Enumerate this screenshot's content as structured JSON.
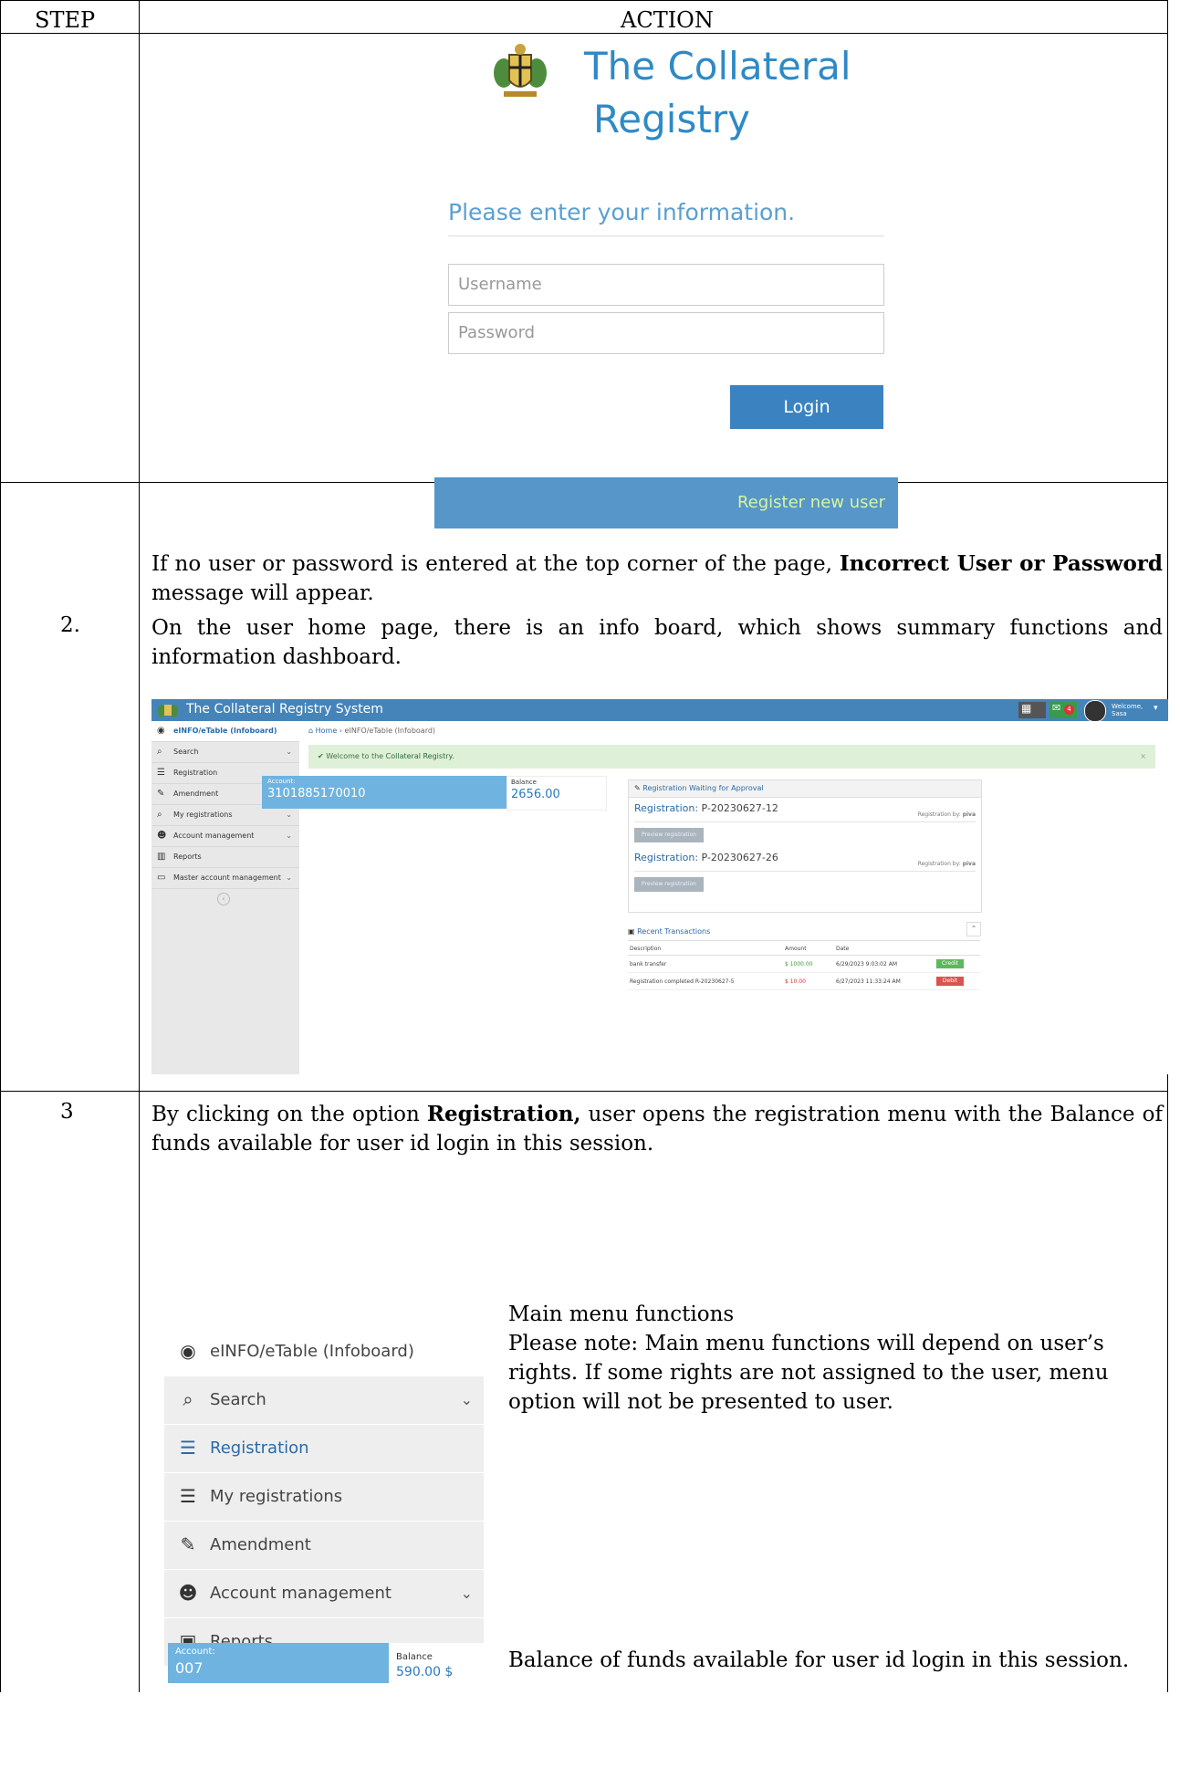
{
  "table": {
    "header_step": "STEP",
    "header_action": "ACTION"
  },
  "step1": {
    "logo_title_line1": "The Collateral",
    "logo_title_line2": "Registry",
    "prompt": "Please enter your information.",
    "username_placeholder": "Username",
    "password_placeholder": "Password",
    "login_label": "Login",
    "register_label": "Register new user",
    "note_pre": "If no user or password is entered at the top corner of the page, ",
    "note_bold": "Incorrect User or Password",
    "note_post": " message will appear."
  },
  "step2": {
    "number": "2.",
    "text": "On the user home page, there is an info board, which shows summary functions and information dashboard.",
    "app_title": "The Collateral Registry System",
    "welcome_user": "Welcome, Sasa",
    "notif_count": "4",
    "sidebar": [
      {
        "icon": "dashboard-icon",
        "glyph": "◉",
        "label": "eINFO/eTable (Infoboard)",
        "chev": ""
      },
      {
        "icon": "search-icon",
        "glyph": "⌕",
        "label": "Search",
        "chev": "⌄"
      },
      {
        "icon": "list-icon",
        "glyph": "☰",
        "label": "Registration",
        "chev": ""
      },
      {
        "icon": "pencil-icon",
        "glyph": "✎",
        "label": "Amendment",
        "chev": ""
      },
      {
        "icon": "search-icon",
        "glyph": "⌕",
        "label": "My registrations",
        "chev": "⌄"
      },
      {
        "icon": "users-icon",
        "glyph": "☻",
        "label": "Account management",
        "chev": "⌄"
      },
      {
        "icon": "chart-icon",
        "glyph": "▥",
        "label": "Reports",
        "chev": ""
      },
      {
        "icon": "monitor-icon",
        "glyph": "▭",
        "label": "Master account management",
        "chev": "⌄"
      }
    ],
    "breadcrumb_home": "Home",
    "breadcrumb_current": "eINFO/eTable (Infoboard)",
    "welcome_banner_pre": "✔ Welcome to the ",
    "welcome_banner_link": "Collateral Registry.",
    "account_label": "Account:",
    "account_number": "3101885170010",
    "balance_label": "Balance",
    "balance_value": "2656.00",
    "waiting_title": "Registration Waiting for Approval",
    "registrations": [
      {
        "label": "Registration:",
        "id": "P-20230627-12",
        "by_label": "Registration by:",
        "by": "piva",
        "button": "Preview registration"
      },
      {
        "label": "Registration:",
        "id": "P-20230627-26",
        "by_label": "Registration by:",
        "by": "piva",
        "button": "Preview registration"
      }
    ],
    "recent_title": "Recent Transactions",
    "tx_headers": [
      "Description",
      "Amount",
      "Date"
    ],
    "transactions": [
      {
        "description": "bank transfer",
        "amount": "$ 1000.00",
        "date": "6/29/2023 9:03:02 AM",
        "type": "Credit"
      },
      {
        "description": "Registration completed R-20230627-5",
        "amount": "$ 10.00",
        "date": "6/27/2023 11:33:24 AM",
        "type": "Debit"
      }
    ]
  },
  "step3": {
    "number": "3",
    "text_pre": "By clicking on the option ",
    "text_bold": "Registration,",
    "text_post": " user opens the registration menu with the Balance of funds available for user id login in this session.",
    "menu": [
      {
        "icon": "dashboard-icon",
        "glyph": "◉",
        "label": "eINFO/eTable (Infoboard)",
        "chev": ""
      },
      {
        "icon": "search-icon",
        "glyph": "⌕",
        "label": "Search",
        "chev": "⌄"
      },
      {
        "icon": "list-icon",
        "glyph": "☰",
        "label": "Registration",
        "chev": ""
      },
      {
        "icon": "list-icon",
        "glyph": "☰",
        "label": "My registrations",
        "chev": ""
      },
      {
        "icon": "pencil-icon",
        "glyph": "✎",
        "label": "Amendment",
        "chev": ""
      },
      {
        "icon": "users-icon",
        "glyph": "☻",
        "label": "Account management",
        "chev": "⌄"
      },
      {
        "icon": "briefcase-icon",
        "glyph": "▣",
        "label": "Reports",
        "chev": "⌄"
      }
    ],
    "menu_caption_title": "Main menu functions",
    "menu_caption_note": "Please note: Main menu functions will depend on user’s rights. If some rights are not assigned to the user, menu option will not be presented to user.",
    "account_label": "Account:",
    "account_number": "007",
    "balance_label": "Balance",
    "balance_value": "590.00 $",
    "balance_caption": "Balance of funds available for user id login in this session."
  }
}
